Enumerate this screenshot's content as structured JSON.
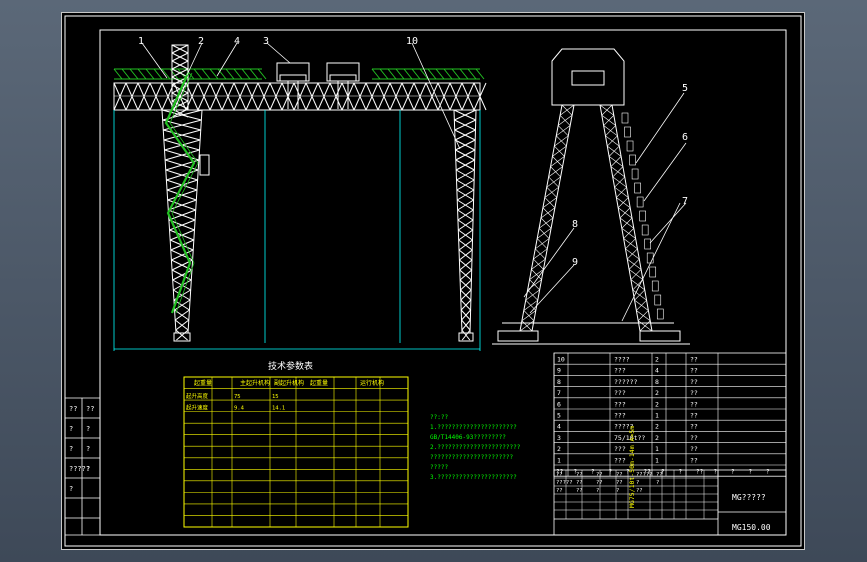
{
  "callouts": [
    "1",
    "2",
    "3",
    "4",
    "5",
    "6",
    "7",
    "8",
    "9",
    "10"
  ],
  "tech_title": "技术参数表",
  "tech_table": {
    "header": [
      "起重量",
      "主起升机构",
      "副起升机构",
      "起重量",
      "运行机构"
    ],
    "rows": [
      [
        "起升高度",
        "",
        "75",
        "15",
        "",
        "",
        ""
      ],
      [
        "起升速度",
        "",
        "9.4",
        "14.1",
        "",
        "",
        ""
      ],
      [
        "",
        "",
        "",
        "",
        "",
        "",
        "",
        ""
      ],
      [
        "",
        "",
        "",
        "",
        "",
        "",
        "",
        ""
      ],
      [
        "",
        "",
        "",
        "",
        "",
        "",
        "",
        ""
      ],
      [
        "",
        "",
        "",
        "",
        "",
        "",
        "",
        ""
      ],
      [
        "",
        "",
        "",
        "",
        "",
        "",
        "",
        ""
      ],
      [
        "",
        "",
        "",
        "",
        "",
        "",
        "",
        ""
      ],
      [
        "",
        "",
        "",
        "",
        "",
        "",
        "",
        ""
      ],
      [
        "",
        "",
        "",
        "",
        "",
        "",
        "",
        ""
      ],
      [
        "",
        "",
        "",
        "",
        "",
        "",
        "",
        ""
      ],
      [
        "",
        "",
        "",
        "",
        "",
        "",
        "",
        ""
      ]
    ]
  },
  "notes": [
    "??:??",
    "1.??????????????????????",
    "  GB/T14406-93?????????",
    "2.???????????????????????",
    "  ???????????????????????",
    "  ?????",
    "3.??????????????????????"
  ],
  "parts_list": [
    {
      "no": "10",
      "name": "????",
      "qty": "2",
      "note": "??"
    },
    {
      "no": "9",
      "name": "???",
      "qty": "4",
      "note": "??"
    },
    {
      "no": "8",
      "name": "??????",
      "qty": "8",
      "note": "??"
    },
    {
      "no": "7",
      "name": "???",
      "qty": "2",
      "note": "??"
    },
    {
      "no": "6",
      "name": "???",
      "qty": "2",
      "note": "??"
    },
    {
      "no": "5",
      "name": "???",
      "qty": "1",
      "note": "??"
    },
    {
      "no": "4",
      "name": "?????",
      "qty": "2",
      "note": "??"
    },
    {
      "no": "3",
      "name": "75/10t??",
      "qty": "2",
      "note": "??"
    },
    {
      "no": "2",
      "name": "???",
      "qty": "1",
      "note": "??"
    },
    {
      "no": "1",
      "name": "???",
      "qty": "1",
      "note": "??"
    }
  ],
  "parts_header": [
    "??",
    "?",
    "?",
    "?",
    "?",
    "??",
    "?",
    "?",
    "??",
    "?",
    "?",
    "?",
    "?"
  ],
  "title_block": {
    "spec": "MG75/10t-50m-14m  A=5m",
    "drawing_name": "MG?????",
    "drawing_no": "MG150.00",
    "cells": [
      "??",
      "??",
      "??",
      "??",
      "?????",
      "??",
      "?????",
      "??",
      "??",
      "??",
      "?",
      "?",
      "??",
      "??",
      "?",
      "?",
      "??"
    ]
  },
  "revision": {
    "cells": [
      "??",
      "??",
      "?",
      "?",
      "?",
      "?",
      "?????",
      "?",
      "?"
    ]
  },
  "colors": {
    "structure": "#ffffff",
    "ladder": "#22c022",
    "table": "#ffff00",
    "lines": "#00ffff",
    "note_text": "#00ff00",
    "sheet": "#000000"
  }
}
